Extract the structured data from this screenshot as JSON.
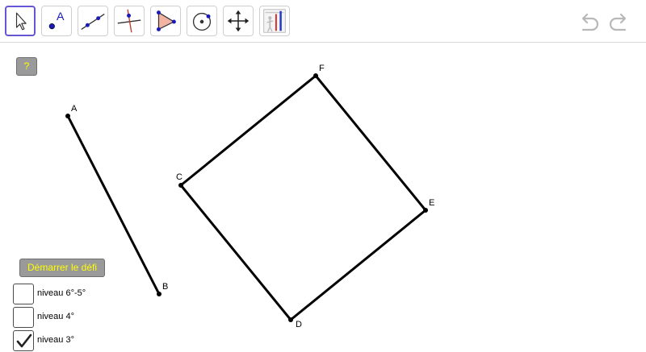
{
  "toolbar": {
    "tools": [
      {
        "name": "move-tool",
        "active": true
      },
      {
        "name": "point-tool",
        "active": false
      },
      {
        "name": "line-tool",
        "active": false
      },
      {
        "name": "perpendicular-line-tool",
        "active": false
      },
      {
        "name": "polygon-tool",
        "active": false
      },
      {
        "name": "circle-tool",
        "active": false
      },
      {
        "name": "move-graphics-view-tool",
        "active": false
      },
      {
        "name": "custom-tool",
        "active": false
      }
    ],
    "point_tool_label": "A",
    "undo_icon": "undo-icon",
    "redo_icon": "redo-icon"
  },
  "buttons": {
    "help_label": "?",
    "start_label": "Démarrer le défi"
  },
  "levels": [
    {
      "label": "niveau 6°-5°",
      "checked": false
    },
    {
      "label": "niveau 4°",
      "checked": false
    },
    {
      "label": "niveau 3°",
      "checked": true
    }
  ],
  "points": {
    "A": "A",
    "B": "B",
    "C": "C",
    "D": "D",
    "E": "E",
    "F": "F"
  },
  "colors": {
    "button_bg": "#9a9a9a",
    "button_text": "#ffff00",
    "active_tool_border": "#6557d2",
    "tool_point_blue": "#1a1ab8"
  }
}
